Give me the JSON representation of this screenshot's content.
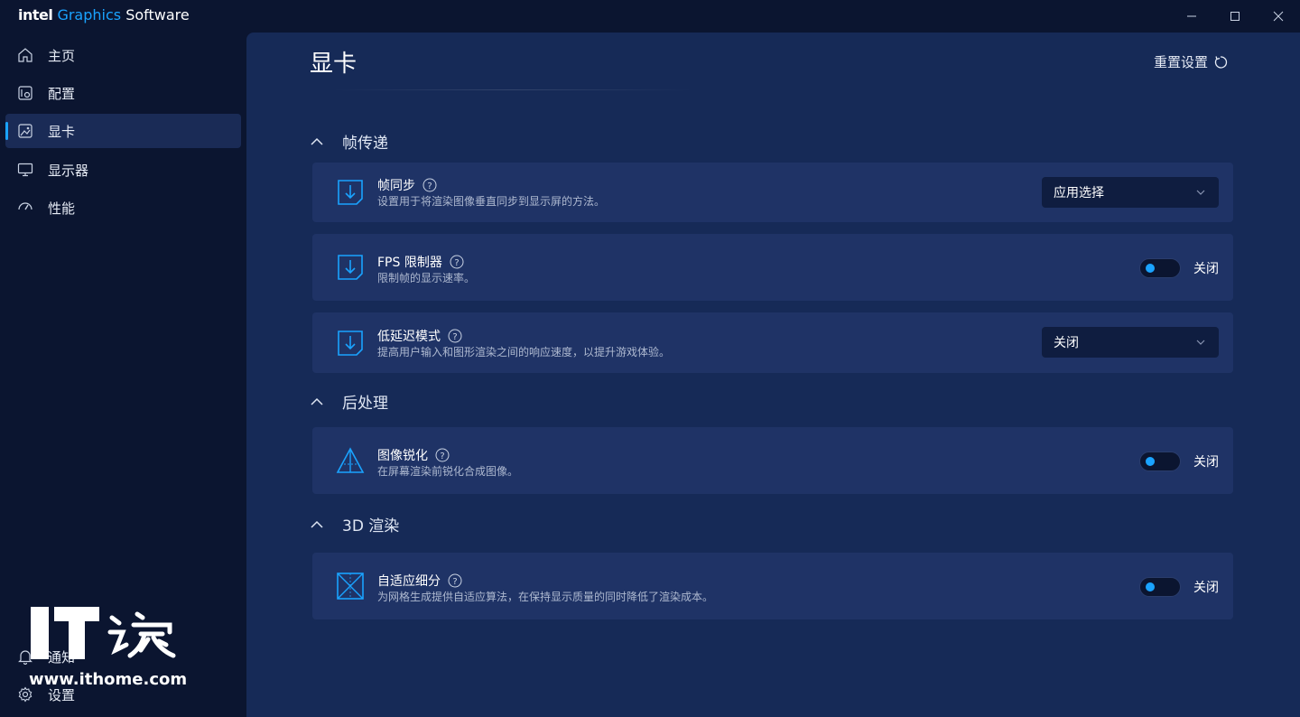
{
  "app": {
    "brand_intel": "intel",
    "brand_graphics": "Graphics",
    "brand_software": "Software"
  },
  "sidebar": {
    "items": [
      {
        "label": "主页",
        "icon": "home-icon"
      },
      {
        "label": "配置",
        "icon": "profile-icon"
      },
      {
        "label": "显卡",
        "icon": "graphics-icon",
        "active": true
      },
      {
        "label": "显示器",
        "icon": "monitor-icon"
      },
      {
        "label": "性能",
        "icon": "performance-icon"
      }
    ],
    "bottom": [
      {
        "label": "通知",
        "icon": "bell-icon"
      },
      {
        "label": "设置",
        "icon": "gear-icon"
      }
    ]
  },
  "watermark": {
    "logo_text": "IT之家",
    "url": "www.ithome.com"
  },
  "main": {
    "title": "显卡",
    "reset_label": "重置设置",
    "sections": [
      {
        "title": "帧传递",
        "items": [
          {
            "title": "帧同步",
            "desc": "设置用于将渲染图像垂直同步到显示屏的方法。",
            "control": "dropdown",
            "value": "应用选择"
          },
          {
            "title": "FPS 限制器",
            "desc": "限制帧的显示速率。",
            "control": "toggle",
            "value": "关闭"
          },
          {
            "title": "低延迟模式",
            "desc": "提高用户输入和图形渲染之间的响应速度，以提升游戏体验。",
            "control": "dropdown",
            "value": "关闭"
          }
        ]
      },
      {
        "title": "后处理",
        "items": [
          {
            "title": "图像锐化",
            "desc": "在屏幕渲染前锐化合成图像。",
            "control": "toggle",
            "value": "关闭"
          }
        ]
      },
      {
        "title": "3D 渲染",
        "items": [
          {
            "title": "自适应细分",
            "desc": "为网格生成提供自适应算法，在保持显示质量的同时降低了渲染成本。",
            "control": "toggle",
            "value": "关闭"
          }
        ]
      }
    ]
  },
  "colors": {
    "accent": "#1aa3ff",
    "sidebar_bg": "#0b1530",
    "main_bg": "#162a57",
    "card_bg": "#1f3366"
  }
}
